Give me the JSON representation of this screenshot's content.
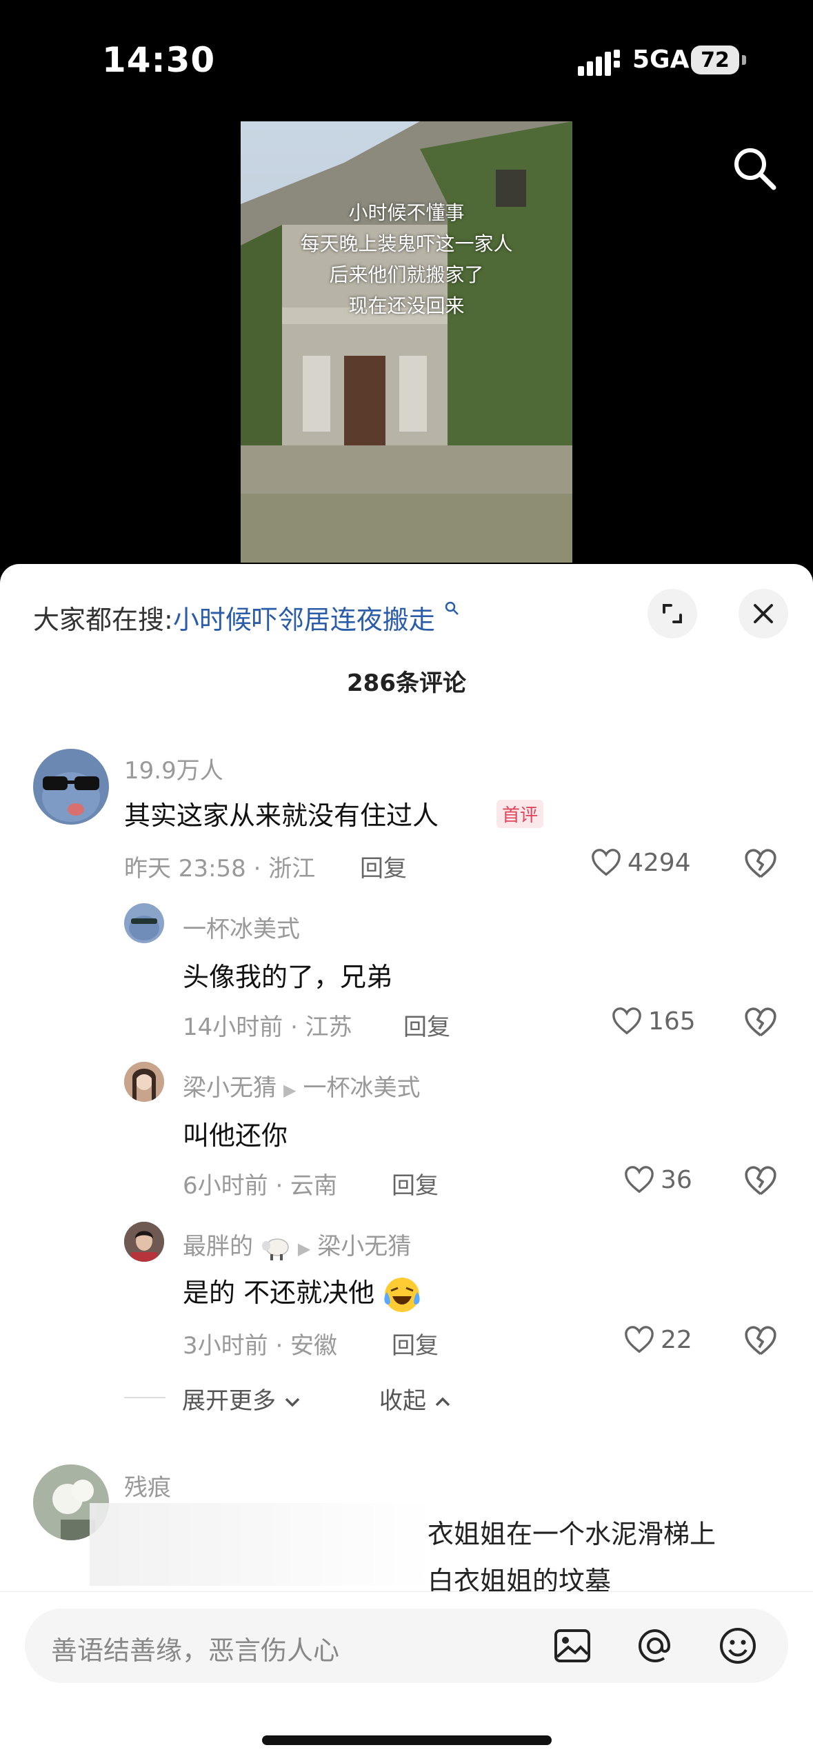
{
  "status": {
    "time": "14:30",
    "network": "5GA",
    "battery": "72"
  },
  "video": {
    "overlay_lines": [
      "小时候不懂事",
      "每天晚上装鬼吓这一家人",
      "后来他们就搬家了",
      "现在还没回来"
    ]
  },
  "panel": {
    "hot_prefix": "大家都在搜:",
    "hot_link": "小时候吓邻居连夜搬走",
    "count": "286条评论"
  },
  "comments": [
    {
      "name": "19.9万人",
      "text": "其实这家从来就没有住过人",
      "tag": "首评",
      "meta": "昨天 23:58 · 浙江",
      "reply": "回复",
      "likes": "4294"
    },
    {
      "name": "一杯冰美式",
      "text": "头像我的了，兄弟",
      "meta": "14小时前 · 江苏",
      "reply": "回复",
      "likes": "165"
    },
    {
      "name": "梁小无猜",
      "reply_to": "一杯冰美式",
      "text": "叫他还你",
      "meta": "6小时前 · 云南",
      "reply": "回复",
      "likes": "36"
    },
    {
      "name": "最胖的",
      "reply_to": "梁小无猜",
      "text": "是的 不还就决他",
      "meta": "3小时前 · 安徽",
      "reply": "回复",
      "likes": "22"
    }
  ],
  "thread": {
    "expand": "展开更多",
    "collapse": "收起"
  },
  "next_comment": {
    "name": "残痕",
    "float_lines": [
      "衣姐姐在一个水泥滑梯上",
      "白衣姐姐的坟墓"
    ]
  },
  "input": {
    "placeholder": "善语结善缘，恶言伤人心"
  },
  "icons": [
    "search-icon",
    "expand-icon",
    "close-icon",
    "heart-icon",
    "broken-heart-icon",
    "image-icon",
    "at-icon",
    "emoji-icon"
  ]
}
